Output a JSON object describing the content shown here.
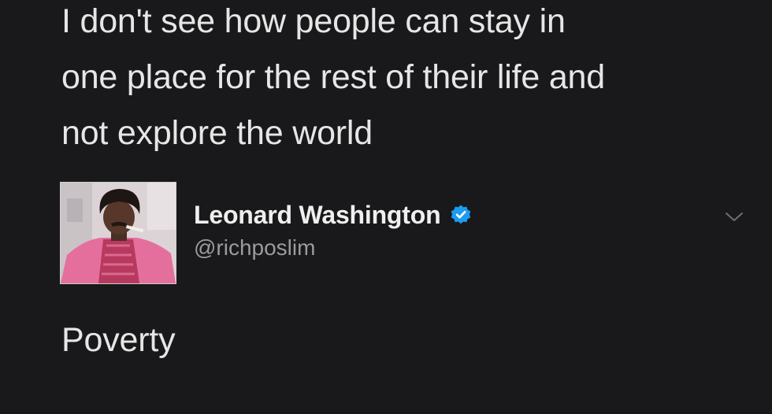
{
  "quoted_tweet": {
    "lines": [
      "I don't see how people can stay in",
      "one place for the rest of their life and",
      "not explore the world"
    ]
  },
  "reply": {
    "author": {
      "display_name": "Leonard Washington",
      "handle": "@richposlim",
      "verified": true,
      "verified_icon": "verified-badge-icon",
      "avatar": "avatar-photo"
    },
    "menu_icon": "chevron-down-icon",
    "text": "Poverty"
  },
  "colors": {
    "background": "#19191b",
    "text": "#e6e6e6",
    "handle": "#9a9a9f",
    "verified": "#1d9bf0",
    "chevron": "#6e6e73"
  }
}
